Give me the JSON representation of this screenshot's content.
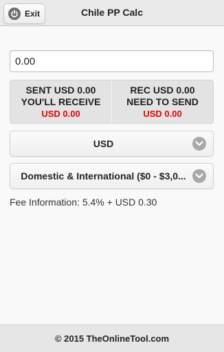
{
  "header": {
    "exit_label": "Exit",
    "title": "Chile PP Calc",
    "exit_icon": "power-icon"
  },
  "amount": {
    "value": "0.00"
  },
  "summary": {
    "left": {
      "line1": "SENT USD 0.00",
      "line2": "YOU'LL RECEIVE",
      "amount": "USD 0.00"
    },
    "right": {
      "line1": "REC USD 0.00",
      "line2": "NEED TO SEND",
      "amount": "USD 0.00"
    }
  },
  "currency_select": {
    "selected": "USD",
    "icon": "chevron-down-icon"
  },
  "type_select": {
    "selected": "Domestic & International ($0 - $3,0...",
    "icon": "chevron-down-icon"
  },
  "fee_info": "Fee Information: 5.4% + USD 0.30",
  "footer": {
    "text": "© 2015 TheOnlineTool.com"
  },
  "colors": {
    "accent_red": "#e60000",
    "header_bg": "#eaeaea",
    "summary_bg": "#e3e3e3"
  }
}
